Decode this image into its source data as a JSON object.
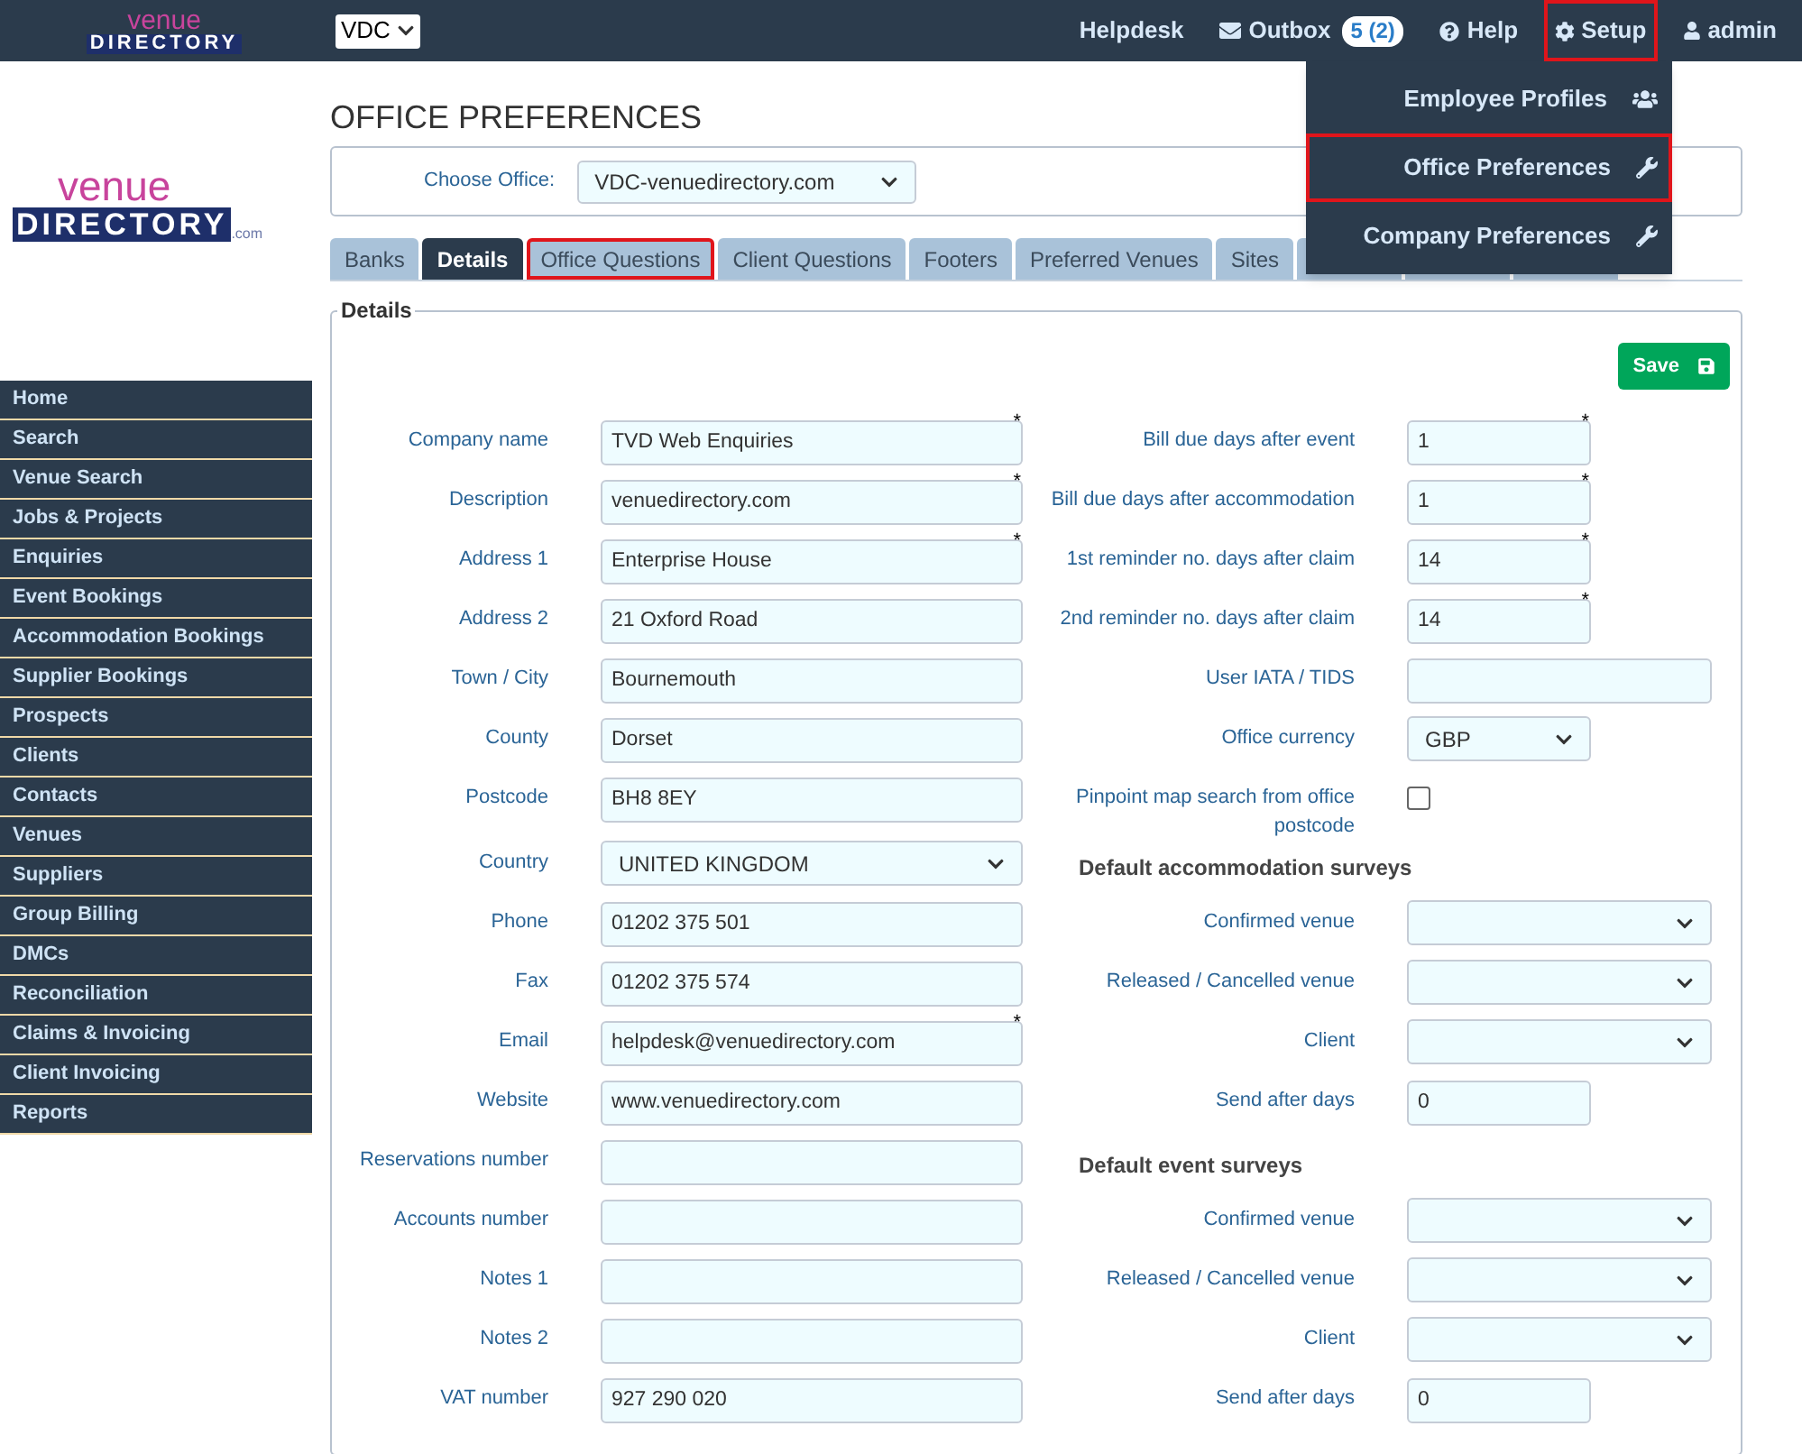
{
  "topbar": {
    "logo_top": "venue",
    "logo_bottom": "DIRECTORY",
    "office_select": "VDC",
    "links": [
      {
        "kind": "plain",
        "label": "Helpdesk",
        "highlighted": false
      },
      {
        "kind": "outbox",
        "label": "Outbox",
        "badge": "5 (2)",
        "highlighted": false
      },
      {
        "kind": "help",
        "label": "Help",
        "highlighted": false
      },
      {
        "kind": "setup",
        "label": "Setup",
        "highlighted": true
      },
      {
        "kind": "user",
        "label": "admin",
        "highlighted": false
      }
    ]
  },
  "setup_menu": [
    {
      "label": "Employee Profiles",
      "highlighted": false
    },
    {
      "label": "Office Preferences",
      "highlighted": true
    },
    {
      "label": "Company Preferences",
      "highlighted": false
    }
  ],
  "required_mark": "*",
  "sidebar": {
    "logo_top": "venue",
    "logo_bottom": "DIRECTORY",
    "logo_suffix": ".com",
    "items": [
      "Home",
      "Search",
      "Venue Search",
      "Jobs & Projects",
      "Enquiries",
      "Event Bookings",
      "Accommodation Bookings",
      "Supplier Bookings",
      "Prospects",
      "Clients",
      "Contacts",
      "Venues",
      "Suppliers",
      "Group Billing",
      "DMCs",
      "Reconciliation",
      "Claims & Invoicing",
      "Client Invoicing",
      "Reports"
    ]
  },
  "page_title": "OFFICE PREFERENCES",
  "choose_office": {
    "label": "Choose Office:",
    "value": "VDC-venuedirectory.com"
  },
  "tabs": [
    {
      "label": "Banks",
      "selected": false,
      "highlighted": false
    },
    {
      "label": "Details",
      "selected": true,
      "highlighted": false
    },
    {
      "label": "Office Questions",
      "selected": false,
      "highlighted": true
    },
    {
      "label": "Client Questions",
      "selected": false,
      "highlighted": false
    },
    {
      "label": "Footers",
      "selected": false,
      "highlighted": false
    },
    {
      "label": "Preferred Venues",
      "selected": false,
      "highlighted": false
    },
    {
      "label": "Sites",
      "selected": false,
      "highlighted": false
    }
  ],
  "section_title": "Details",
  "save_button": "Save",
  "left_fields": [
    {
      "kind": "text",
      "label": "Company name",
      "value": "TVD Web Enquiries",
      "required": true
    },
    {
      "kind": "text",
      "label": "Description",
      "value": "venuedirectory.com",
      "required": true
    },
    {
      "kind": "text",
      "label": "Address 1",
      "value": "Enterprise House",
      "required": true
    },
    {
      "kind": "text",
      "label": "Address 2",
      "value": "21 Oxford Road",
      "required": false
    },
    {
      "kind": "text",
      "label": "Town / City",
      "value": "Bournemouth",
      "required": false
    },
    {
      "kind": "text",
      "label": "County",
      "value": "Dorset",
      "required": false
    },
    {
      "kind": "text",
      "label": "Postcode",
      "value": "BH8 8EY",
      "required": false
    },
    {
      "kind": "select",
      "label": "Country",
      "value": "UNITED KINGDOM"
    },
    {
      "kind": "text",
      "label": "Phone",
      "value": "01202 375 501",
      "required": false
    },
    {
      "kind": "text",
      "label": "Fax",
      "value": "01202 375 574",
      "required": false
    },
    {
      "kind": "text",
      "label": "Email",
      "value": "helpdesk@venuedirectory.com",
      "required": true
    },
    {
      "kind": "text",
      "label": "Website",
      "value": "www.venuedirectory.com",
      "required": false
    },
    {
      "kind": "text",
      "label": "Reservations number",
      "required": false
    },
    {
      "kind": "text",
      "label": "Accounts number",
      "required": false
    },
    {
      "kind": "text",
      "label": "Notes 1",
      "required": false
    },
    {
      "kind": "text",
      "label": "Notes 2",
      "required": false
    },
    {
      "kind": "text",
      "label": "VAT number",
      "value": "927 290 020",
      "required": false
    }
  ],
  "right_items": [
    {
      "kind": "text",
      "label": "Bill due days after event",
      "value": "1",
      "required": true
    },
    {
      "kind": "text",
      "label": "Bill due days after accommodation",
      "value": "1",
      "required": true
    },
    {
      "kind": "text",
      "label": "1st reminder no. days after claim",
      "value": "14",
      "required": true
    },
    {
      "kind": "text",
      "label": "2nd reminder no. days after claim",
      "value": "14",
      "required": true
    },
    {
      "kind": "text",
      "label": "User IATA / TIDS",
      "required": false
    },
    {
      "kind": "select",
      "label": "Office currency",
      "value": "GBP"
    },
    {
      "kind": "checkbox",
      "label": "Pinpoint map search from office postcode",
      "checked": false
    },
    {
      "kind": "heading",
      "label": "Default accommodation surveys"
    },
    {
      "kind": "select",
      "label": "Confirmed venue"
    },
    {
      "kind": "select",
      "label": "Released / Cancelled venue"
    },
    {
      "kind": "select",
      "label": "Client"
    },
    {
      "kind": "text",
      "label": "Send after days",
      "value": "0",
      "required": false
    },
    {
      "kind": "heading",
      "label": "Default event surveys"
    },
    {
      "kind": "select",
      "label": "Confirmed venue"
    },
    {
      "kind": "select",
      "label": "Released / Cancelled venue"
    },
    {
      "kind": "select",
      "label": "Client"
    },
    {
      "kind": "text",
      "label": "Send after days",
      "value": "0",
      "required": false
    }
  ]
}
